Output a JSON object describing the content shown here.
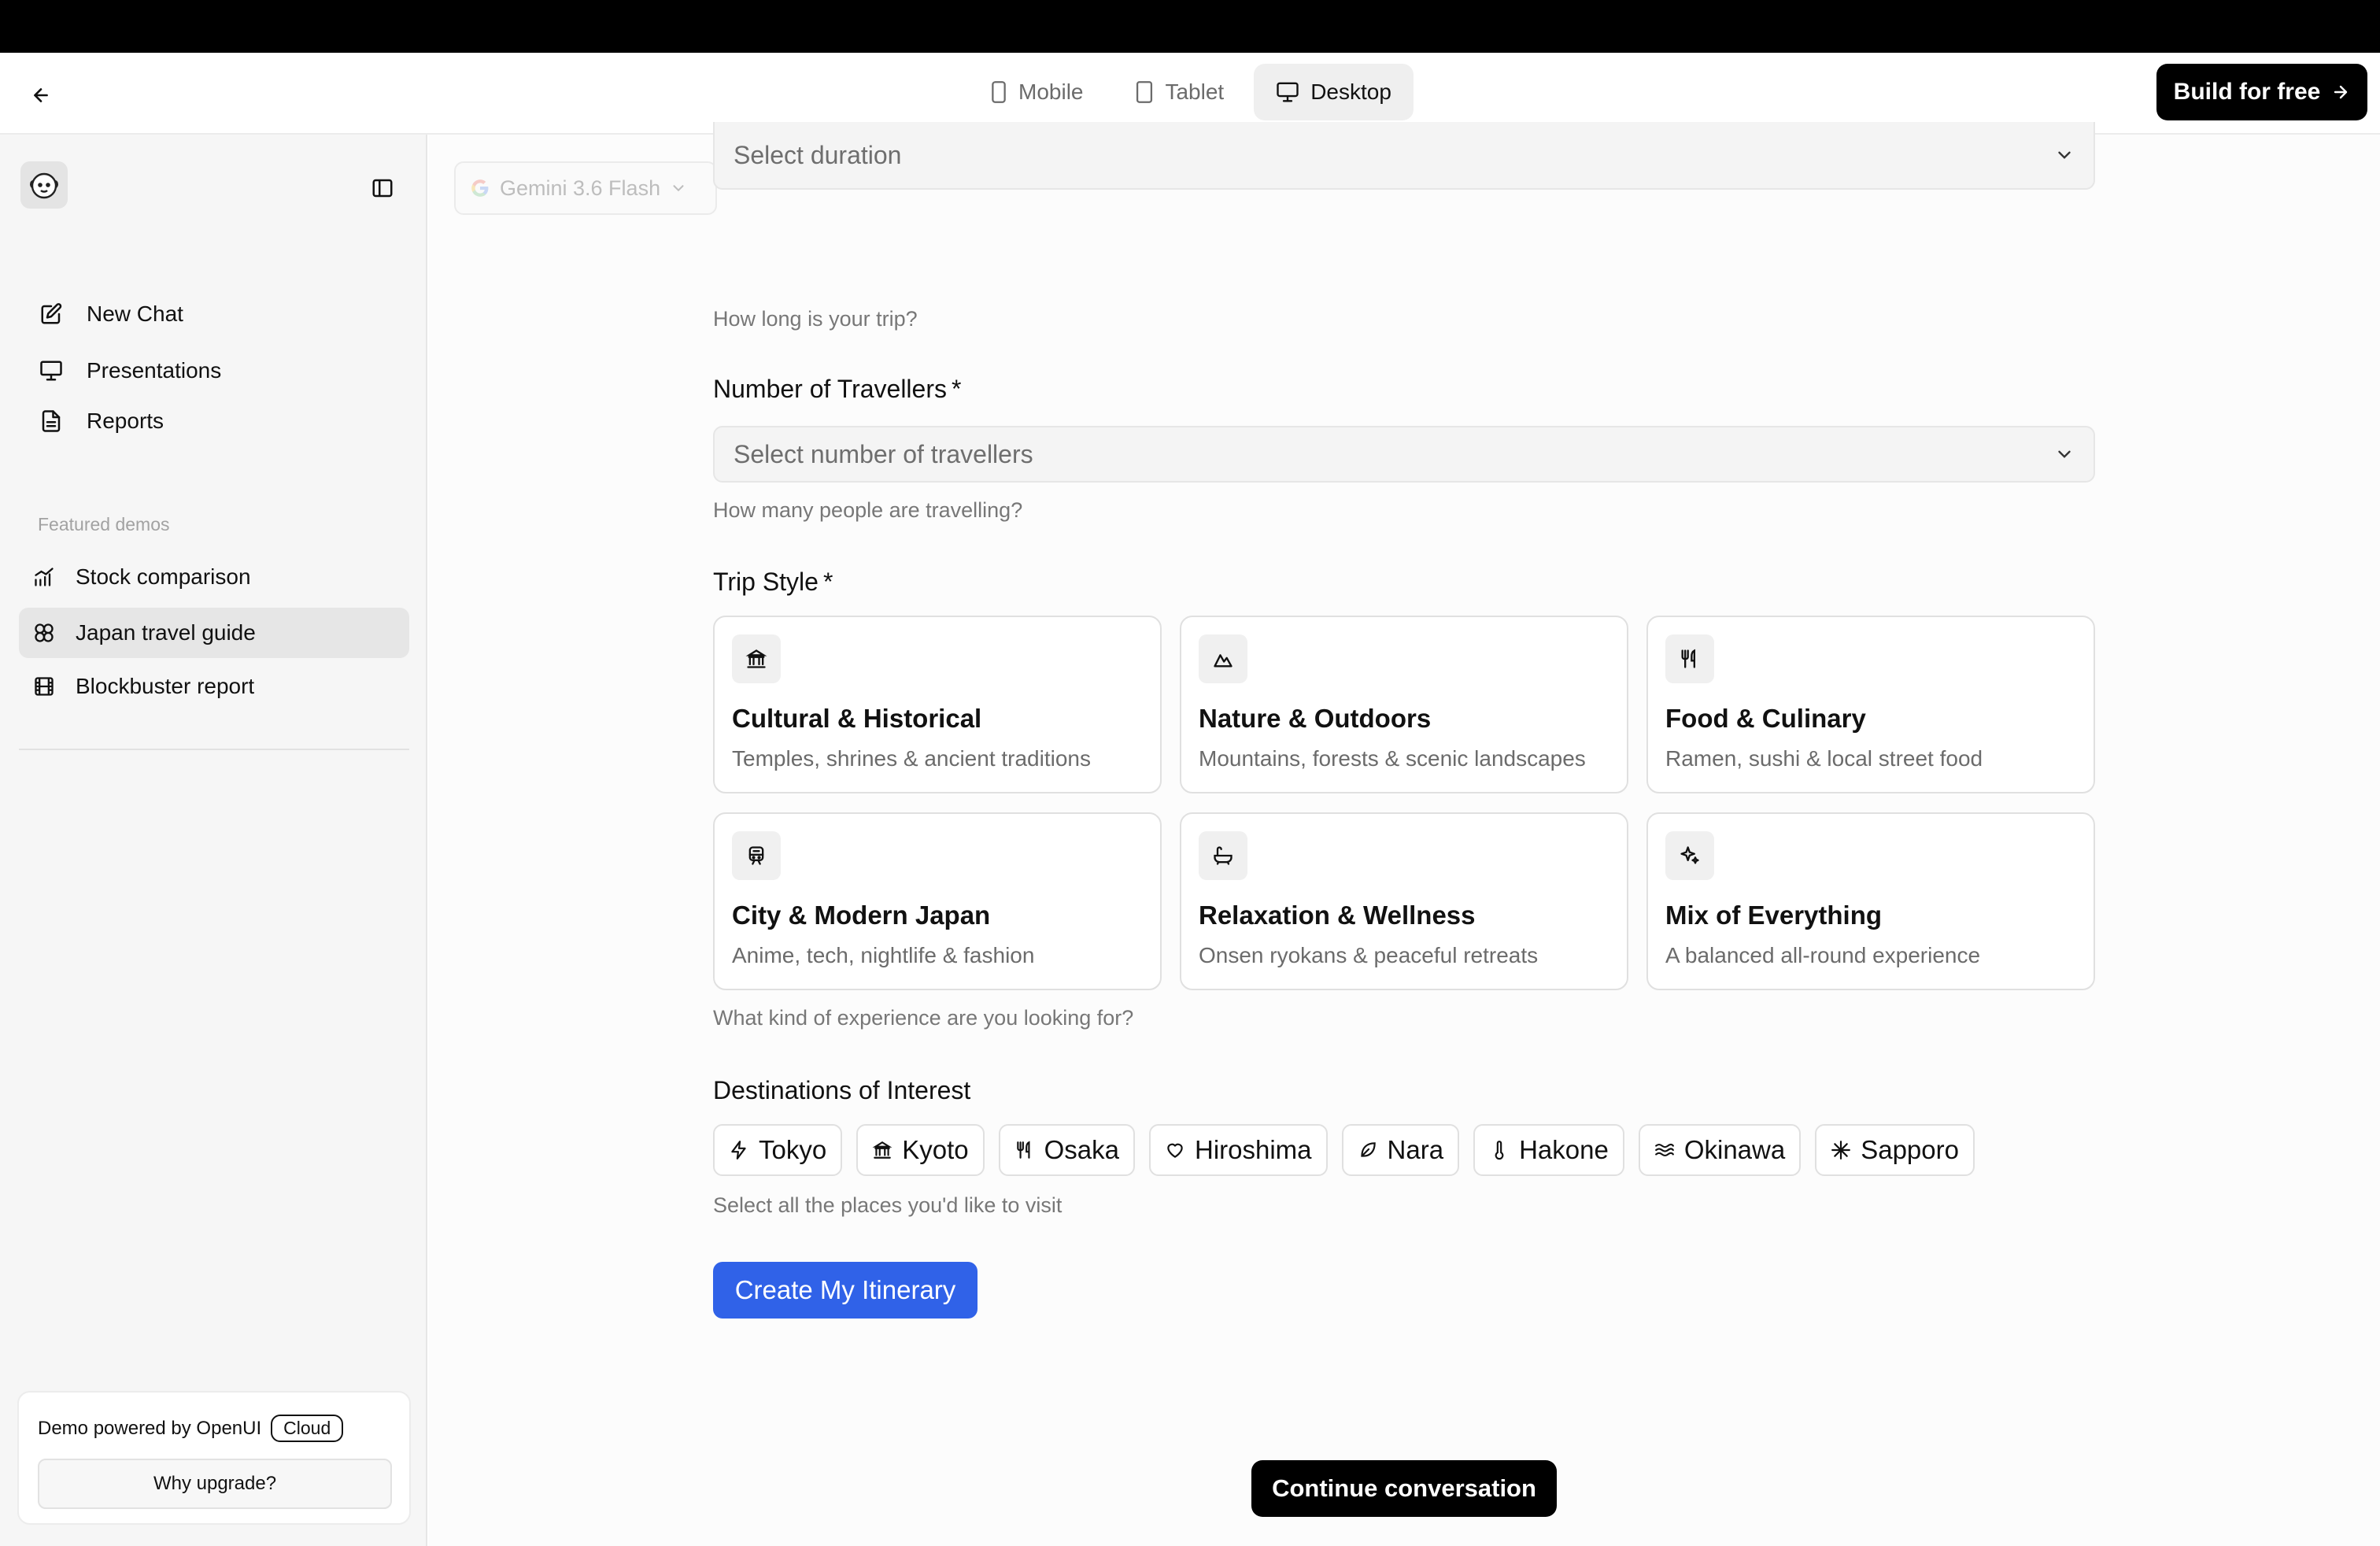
{
  "header": {
    "device_tabs": [
      {
        "label": "Mobile",
        "icon": "mobile-icon",
        "active": false
      },
      {
        "label": "Tablet",
        "icon": "tablet-icon",
        "active": false
      },
      {
        "label": "Desktop",
        "icon": "desktop-icon",
        "active": true
      }
    ],
    "build_label": "Build for free"
  },
  "sidebar": {
    "nav": [
      {
        "label": "New Chat",
        "icon": "new-chat-icon"
      },
      {
        "label": "Presentations",
        "icon": "presentation-icon"
      },
      {
        "label": "Reports",
        "icon": "report-icon"
      }
    ],
    "featured_label": "Featured demos",
    "demos": [
      {
        "label": "Stock comparison",
        "icon": "chart-icon",
        "active": false
      },
      {
        "label": "Japan travel guide",
        "icon": "globe-icon",
        "active": true
      },
      {
        "label": "Blockbuster report",
        "icon": "film-icon",
        "active": false
      }
    ],
    "promo": {
      "text": "Demo powered by OpenUI",
      "badge": "Cloud",
      "button": "Why upgrade?"
    }
  },
  "main": {
    "model": "Gemini 3.6 Flash",
    "duration": {
      "placeholder": "Select duration",
      "help": "How long is your trip?"
    },
    "travellers": {
      "label": "Number of Travellers",
      "required": "*",
      "placeholder": "Select number of travellers",
      "help": "How many people are travelling?"
    },
    "trip_style": {
      "label": "Trip Style",
      "required": "*",
      "help": "What kind of experience are you looking for?",
      "options": [
        {
          "title": "Cultural & Historical",
          "desc": "Temples, shrines & ancient traditions",
          "icon": "landmark-icon"
        },
        {
          "title": "Nature & Outdoors",
          "desc": "Mountains, forests & scenic landscapes",
          "icon": "mountain-icon"
        },
        {
          "title": "Food & Culinary",
          "desc": "Ramen, sushi & local street food",
          "icon": "utensils-icon"
        },
        {
          "title": "City & Modern Japan",
          "desc": "Anime, tech, nightlife & fashion",
          "icon": "train-icon"
        },
        {
          "title": "Relaxation & Wellness",
          "desc": "Onsen ryokans & peaceful retreats",
          "icon": "bath-icon"
        },
        {
          "title": "Mix of Everything",
          "desc": "A balanced all-round experience",
          "icon": "sparkles-icon"
        }
      ]
    },
    "destinations": {
      "label": "Destinations of Interest",
      "help": "Select all the places you'd like to visit",
      "options": [
        {
          "label": "Tokyo",
          "icon": "zap-icon"
        },
        {
          "label": "Kyoto",
          "icon": "landmark-icon"
        },
        {
          "label": "Osaka",
          "icon": "utensils-icon"
        },
        {
          "label": "Hiroshima",
          "icon": "heart-icon"
        },
        {
          "label": "Nara",
          "icon": "leaf-icon"
        },
        {
          "label": "Hakone",
          "icon": "thermometer-icon"
        },
        {
          "label": "Okinawa",
          "icon": "waves-icon"
        },
        {
          "label": "Sapporo",
          "icon": "snowflake-icon"
        }
      ]
    },
    "submit_label": "Create My Itinerary",
    "continue_label": "Continue conversation"
  }
}
